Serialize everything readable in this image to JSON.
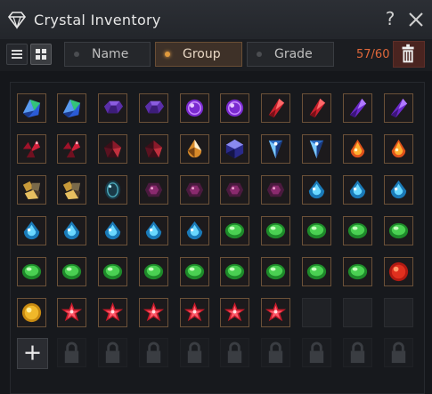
{
  "window": {
    "title": "Crystal Inventory",
    "help_label": "?"
  },
  "toolbar": {
    "filters": [
      {
        "label": "Name",
        "active": false
      },
      {
        "label": "Group",
        "active": true
      },
      {
        "label": "Grade",
        "active": false
      }
    ],
    "capacity": "57/60"
  },
  "colors": {
    "accent": "#e0673a",
    "frame": "#6b5138",
    "active_dot": "#e09a3d"
  },
  "inventory": {
    "columns": 10,
    "rows": [
      [
        "emerald-blue",
        "emerald-blue",
        "amethyst-hex",
        "amethyst-hex",
        "amethyst-orb",
        "amethyst-orb",
        "ruby-shard",
        "ruby-shard",
        "amethyst-shard",
        "amethyst-shard"
      ],
      [
        "garnet-cluster",
        "garnet-cluster",
        "garnet-cut",
        "garnet-cut",
        "gold-drop",
        "sapphire-hex",
        "crystal-prism",
        "crystal-prism",
        "fire-drop",
        "fire-drop"
      ],
      [
        "gold-cluster",
        "gold-cluster",
        "teal-gem",
        "violet-gem",
        "violet-gem",
        "violet-gem",
        "violet-gem",
        "aqua-drop",
        "aqua-drop",
        "aqua-drop"
      ],
      [
        "aqua-drop",
        "aqua-drop",
        "aqua-drop",
        "aqua-drop",
        "aqua-drop",
        "green-gem",
        "green-gem",
        "green-gem",
        "green-gem",
        "green-gem"
      ],
      [
        "green-gem",
        "green-gem",
        "green-gem",
        "green-gem",
        "green-gem",
        "green-gem",
        "green-gem",
        "green-gem",
        "green-gem",
        "red-orb"
      ],
      [
        "gold-orb",
        "red-star",
        "red-star",
        "red-star",
        "red-star",
        "red-star",
        "red-star",
        "empty",
        "empty",
        "empty"
      ],
      [
        "add",
        "locked",
        "locked",
        "locked",
        "locked",
        "locked",
        "locked",
        "locked",
        "locked",
        "locked"
      ]
    ]
  }
}
